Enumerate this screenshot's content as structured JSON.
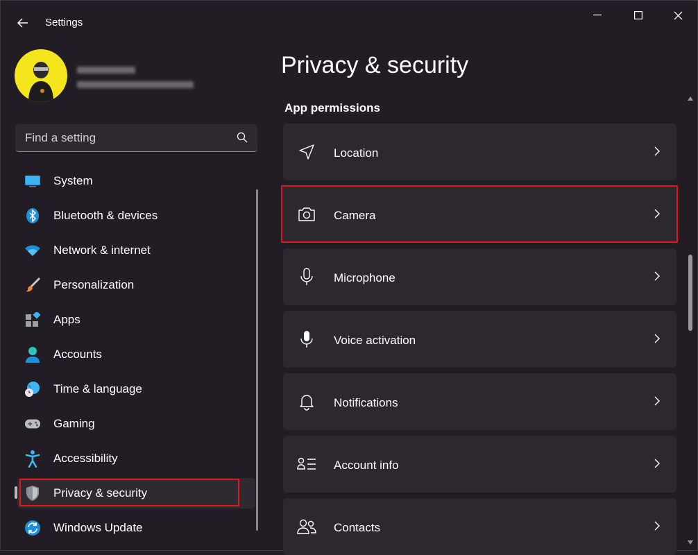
{
  "window": {
    "title": "Settings"
  },
  "search": {
    "placeholder": "Find a setting"
  },
  "sidebar": {
    "items": [
      {
        "label": "System",
        "icon": "monitor-icon"
      },
      {
        "label": "Bluetooth & devices",
        "icon": "bluetooth-icon"
      },
      {
        "label": "Network & internet",
        "icon": "wifi-icon"
      },
      {
        "label": "Personalization",
        "icon": "brush-icon"
      },
      {
        "label": "Apps",
        "icon": "apps-icon"
      },
      {
        "label": "Accounts",
        "icon": "person-icon"
      },
      {
        "label": "Time & language",
        "icon": "globe-clock-icon"
      },
      {
        "label": "Gaming",
        "icon": "gamepad-icon"
      },
      {
        "label": "Accessibility",
        "icon": "accessibility-icon"
      },
      {
        "label": "Privacy & security",
        "icon": "shield-icon",
        "selected": true
      },
      {
        "label": "Windows Update",
        "icon": "update-icon"
      }
    ]
  },
  "main": {
    "page_title": "Privacy & security",
    "section_title": "App permissions",
    "permissions": [
      {
        "label": "Location",
        "icon": "location-arrow-icon"
      },
      {
        "label": "Camera",
        "icon": "camera-icon",
        "highlighted": true
      },
      {
        "label": "Microphone",
        "icon": "microphone-icon"
      },
      {
        "label": "Voice activation",
        "icon": "voice-mic-icon"
      },
      {
        "label": "Notifications",
        "icon": "bell-icon"
      },
      {
        "label": "Account info",
        "icon": "account-info-icon"
      },
      {
        "label": "Contacts",
        "icon": "contacts-icon"
      }
    ]
  },
  "colors": {
    "background": "#221c24",
    "card": "#2d282e",
    "highlight": "#e0181b",
    "accent": "#4cc2ff"
  }
}
